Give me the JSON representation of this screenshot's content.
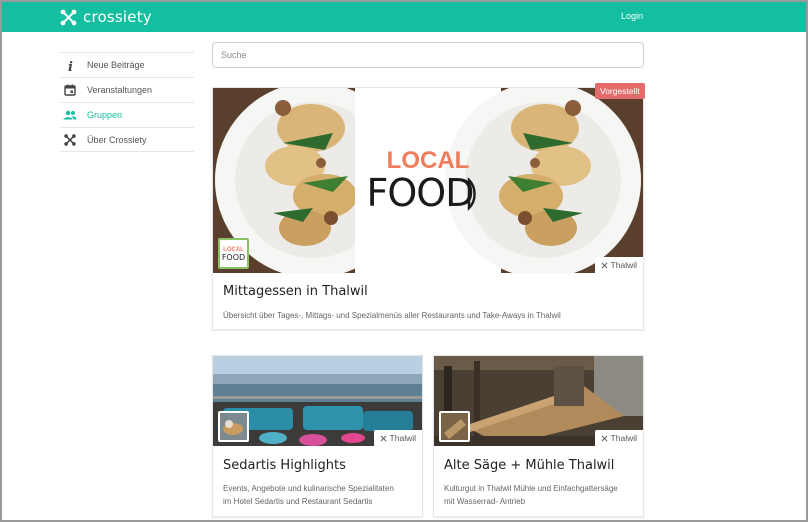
{
  "header": {
    "brand": "crossiety",
    "login_label": "Login"
  },
  "sidebar": {
    "items": [
      {
        "label": "Neue Beiträge",
        "icon": "info-icon"
      },
      {
        "label": "Veranstaltungen",
        "icon": "calendar-icon"
      },
      {
        "label": "Gruppen",
        "icon": "groups-icon",
        "active": true
      },
      {
        "label": "Über Crossiety",
        "icon": "crossiety-icon"
      }
    ]
  },
  "search": {
    "placeholder": "Suche"
  },
  "colors": {
    "accent": "#13bfa0",
    "badge": "#e36b6b",
    "local_food_orange": "#ee7d5b"
  },
  "featured": {
    "badge": "Vorgestellt",
    "image_text_top": "LOCAL",
    "image_text_bottom": "FOOD",
    "thumb_text_top": "LOCAL",
    "thumb_text_bottom": "FOOD",
    "location": "Thalwil",
    "title": "Mittagessen in Thalwil",
    "description": "Übersicht über Tages-, Mittags- und Spezialmenüs aller Restaurants und Take-Aways in Thalwil"
  },
  "cards": [
    {
      "location": "Thalwil",
      "title": "Sedartis Highlights",
      "description_line1": "Events, Angebote und kulinarische Spezialitaten",
      "description_line2": "im Hotel Sedartis und Restaurant Sedartis"
    },
    {
      "location": "Thalwil",
      "title": "Alte Säge + Mühle Thalwil",
      "description_line1": "Kulturgut in Thalwil Mühle und Einfachgattersäge",
      "description_line2": "mit Wasserrad- Antrieb"
    }
  ]
}
